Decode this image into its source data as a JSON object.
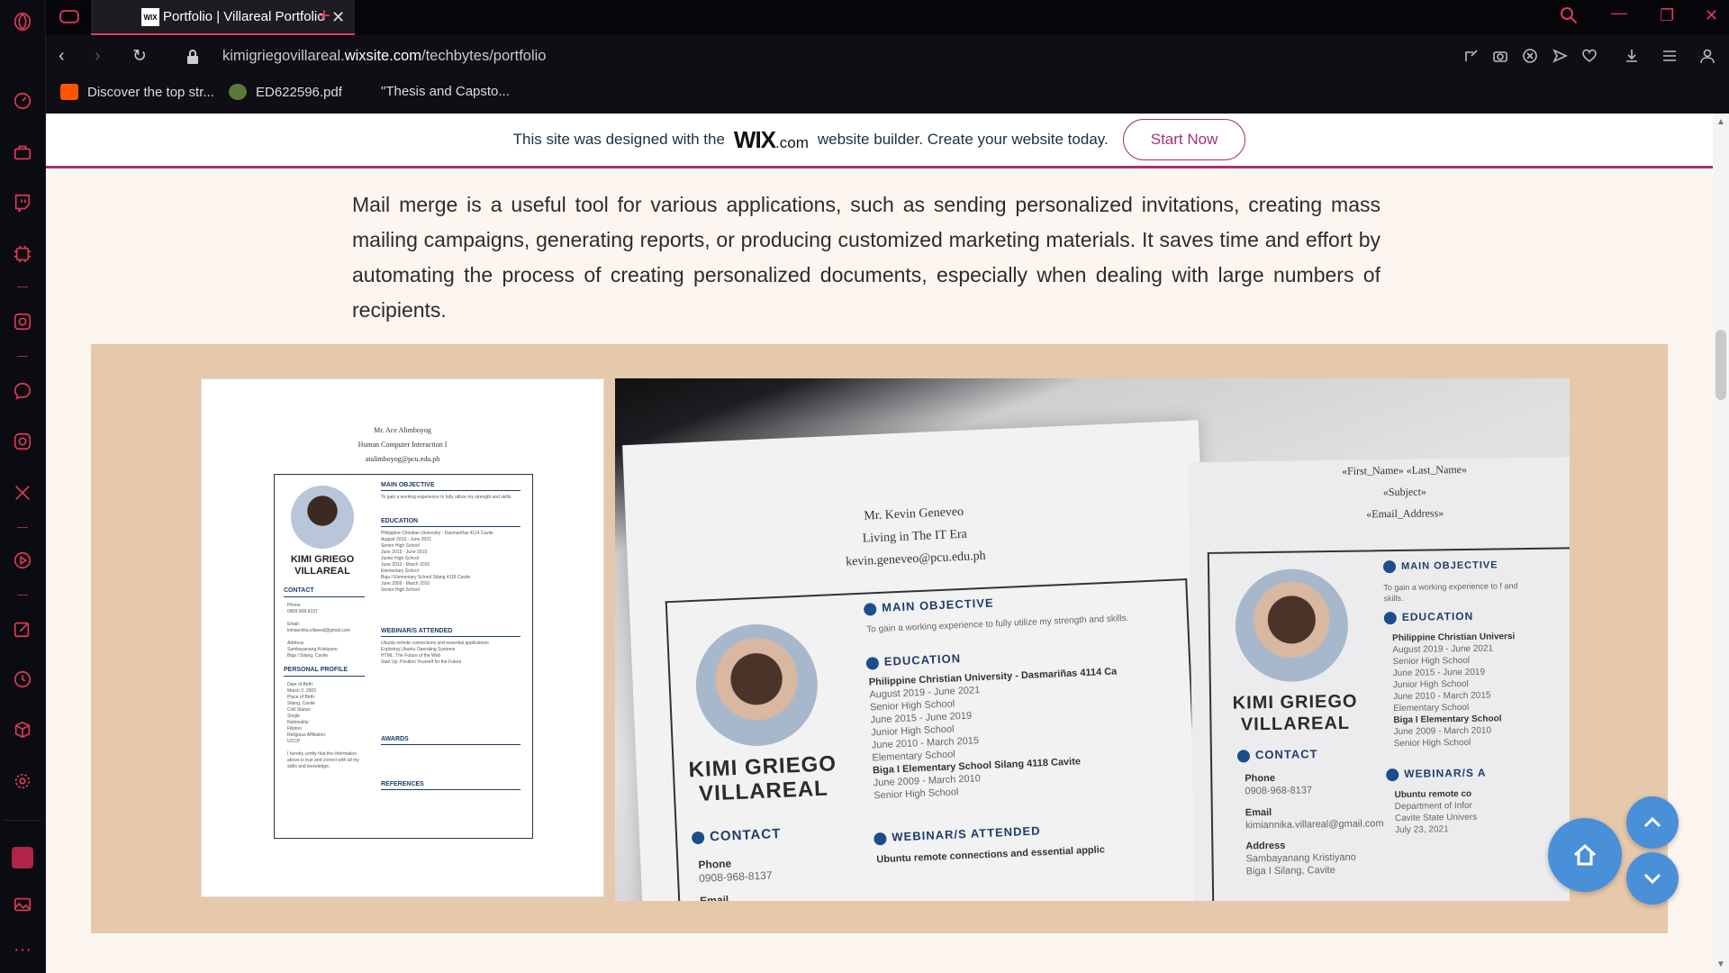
{
  "browser": {
    "tab_title": "Portfolio | Villareal Portfolio",
    "tab_favicon": "WIX",
    "url_prefix": "kimigriegovillareal.",
    "url_domain": "wixsite.com",
    "url_path": "/techbytes/portfolio",
    "bookmarks": [
      {
        "label": "Discover the top str...",
        "icon": "soundcloud-icon"
      },
      {
        "label": "ED622596.pdf",
        "icon": "pdf-icon"
      },
      {
        "label": "\"Thesis and Capsto...",
        "icon": "document-icon"
      }
    ]
  },
  "sidebar": {
    "icons": [
      "opera-icon",
      "speed-dial-icon",
      "briefcase-icon",
      "twitch-icon",
      "gx-control-icon",
      "chatgpt-icon",
      "messenger-icon",
      "instagram-icon",
      "x-icon",
      "player-icon",
      "pinboard-icon",
      "history-icon",
      "extensions-icon",
      "settings-icon",
      "gx-corner-icon",
      "gallery-icon",
      "more-icon"
    ]
  },
  "wix_banner": {
    "text_before": "This site was designed with the",
    "logo": "WIX",
    "logo_suffix": ".com",
    "text_after": "website builder. Create your website today.",
    "button": "Start Now"
  },
  "content": {
    "paragraph": "Mail merge is a useful tool for various applications, such as sending personalized invitations, creating mass mailing campaigns, generating reports, or producing customized marketing materials. It saves time and effort by automating the process of creating personalized documents, especially when dealing with large numbers of recipients."
  },
  "resume_small": {
    "header": [
      "Mr. Ace Alimboyog",
      "Human Computer Interaction I",
      "atalimboyog@pcu.edu.ph"
    ],
    "name": "KIMI GRIEGO VILLAREAL",
    "sections": [
      "MAIN OBJECTIVE",
      "EDUCATION",
      "CONTACT",
      "WEBINAR/S ATTENDED",
      "PERSONAL PROFILE",
      "AWARDS",
      "REFERENCES"
    ],
    "objective": "To gain a working experience to fully utilize my strength and skills."
  },
  "resume_photo": {
    "left_header": [
      "Mr. Kevin Geneveo",
      "Living in The IT Era",
      "kevin.geneveo@pcu.edu.ph"
    ],
    "right_header": [
      "«First_Name» «Last_Name»",
      "«Subject»",
      "«Email_Address»"
    ],
    "name": "KIMI GRIEGO VILLAREAL",
    "main_objective": "MAIN OBJECTIVE",
    "objective_text": "To gain a working experience to fully utilize my strength and skills.",
    "education": "EDUCATION",
    "edu_items": [
      "Philippine Christian University - Dasmariñas 4114 Ca",
      "August 2019 - June 2021",
      "Senior High School",
      "June 2015 - June 2019",
      "Junior High School",
      "June 2010 - March 2015",
      "Elementary School",
      "Biga I Elementary School Silang 4118 Cavite",
      "June 2009 - March 2010",
      "Senior High School"
    ],
    "webinar": "WEBINAR/S ATTENDED",
    "webinar_item": "Ubuntu remote connections and essential applic",
    "contact": "CONTACT",
    "phone_label": "Phone",
    "phone": "0908-968-8137",
    "email_label": "Email",
    "email": "kimiannika.villareal@gmail.com",
    "address_label": "Address",
    "address1": "Sambayanang Kristiyano",
    "address2": "Biga I Silang, Cavite",
    "right_webinar": "WEBINAR/S A",
    "right_webinar_item": "Ubuntu remote co",
    "right_webinar_sub": "Department of Infor",
    "right_webinar_sub2": "Cavite State Univers",
    "right_webinar_date": "July 23, 2021",
    "right_edu": [
      "Philippine Christian Universi",
      "August 2019 - June 2021",
      "Senior High School",
      "June 2015 - June 2019",
      "Junior High School",
      "June 2010 - March 2015",
      "Elementary School",
      "Biga I Elementary School",
      "June 2009 - March 2010",
      "Senior High School"
    ],
    "right_objective": "To gain a working experience to f and skills."
  },
  "colors": {
    "accent": "#e23a5a",
    "wix_purple": "#a83273",
    "gallery_bg": "#e6c8aa",
    "fab_blue": "#4a90d9"
  }
}
